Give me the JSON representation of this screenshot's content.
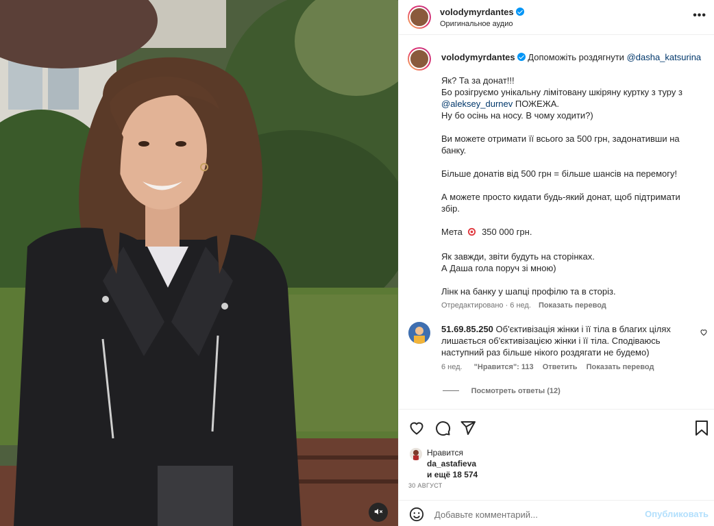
{
  "post": {
    "author": "volodymyrdantes",
    "audio": "Оригинальное аудио"
  },
  "caption": {
    "author": "volodymyrdantes",
    "lead": "Допоможіть роздягнути",
    "lead_mention": "@dasha_katsurina",
    "lines": {
      "l1": "Як? Та за донат!!!",
      "l2": "Бо розігруємо унікальну лімітовану шкіряну куртку з туру з",
      "l3_mention": "@aleksey_durnev",
      "l3_rest": " ПОЖЕЖА.",
      "l4": "Ну бо осінь на носу. В чому ходити?)",
      "l5": "Ви можете отримати її всього за 500 грн, задонативши на",
      "l6": "банку.",
      "l7": "Більше донатів від 500 грн = більше шансів на перемогу!",
      "l8": "А можете просто кидати будь-який донат, щоб підтримати",
      "l9": "збір.",
      "l10_a": "Мета",
      "l10_b": "350 000 грн.",
      "l11": "Як завжди, звіти будуть на сторінках.",
      "l12": "А Даша гола поруч зі мною)",
      "l13": "Лінк на банку у шапці профілю та в сторіз."
    },
    "edited": "Отредактировано · 6 нед.",
    "translate": "Показать перевод"
  },
  "comment": {
    "author": "51.69.85.250",
    "text_1": "Об'єктивізація жінки і її тіла в благих цілях",
    "text_2": "лишається об'єктивізацією жінки і її тіла. Сподіваюсь",
    "text_3": "наступний раз більше нікого роздягати не будемо)",
    "age": "6 нед.",
    "likes": "\"Нравится\": 113",
    "reply": "Ответить",
    "translate": "Показать перевод",
    "view_replies": "Посмотреть ответы (12)"
  },
  "likes": {
    "prefix": "Нравится",
    "user": "da_astafieva",
    "others": "и ещё 18 574"
  },
  "date": "30 АВГУСТ",
  "add_comment": {
    "placeholder": "Добавьте комментарий...",
    "publish": "Опубликовать"
  },
  "colors": {
    "link": "#00376b",
    "verified": "#0095f6",
    "muted": "#737373",
    "publish_disabled": "#b2dffc"
  },
  "icons": {
    "header_more": "more-horizontal-icon",
    "like": "heart-icon",
    "comment": "comment-bubble-icon",
    "share": "paper-plane-icon",
    "save": "bookmark-icon",
    "emoji": "smiley-icon",
    "mute": "speaker-muted-icon",
    "goal": "target-emoji-icon"
  }
}
